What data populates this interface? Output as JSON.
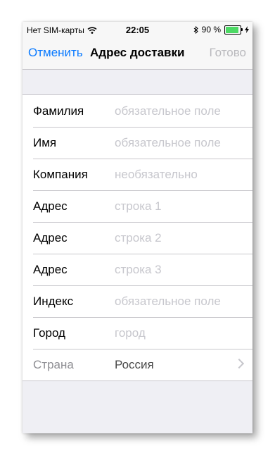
{
  "status": {
    "carrier": "Нет SIM-карты",
    "time": "22:05",
    "battery_percent": "90 %",
    "battery_level": 0.9
  },
  "nav": {
    "cancel": "Отменить",
    "title": "Адрес доставки",
    "done": "Готово"
  },
  "form": {
    "rows": [
      {
        "label": "Фамилия",
        "placeholder": "обязательное поле"
      },
      {
        "label": "Имя",
        "placeholder": "обязательное поле"
      },
      {
        "label": "Компания",
        "placeholder": "необязательно"
      },
      {
        "label": "Адрес",
        "placeholder": "строка 1"
      },
      {
        "label": "Адрес",
        "placeholder": "строка 2"
      },
      {
        "label": "Адрес",
        "placeholder": "строка 3"
      },
      {
        "label": "Индекс",
        "placeholder": "обязательное поле"
      },
      {
        "label": "Город",
        "placeholder": "город"
      }
    ],
    "country": {
      "label": "Страна",
      "value": "Россия"
    }
  },
  "colors": {
    "accent": "#0a7aff",
    "placeholder": "#c7c7cd",
    "battery": "#4cd964"
  }
}
